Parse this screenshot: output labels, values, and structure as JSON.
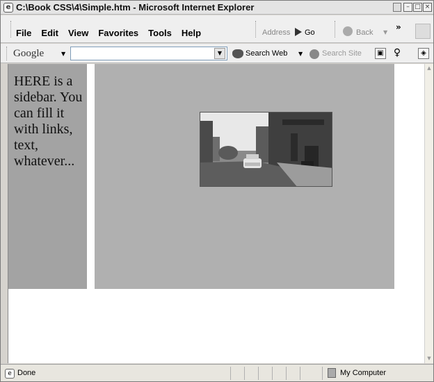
{
  "window": {
    "title": "C:\\Book CSS\\4\\Simple.htm - Microsoft Internet Explorer"
  },
  "menu": {
    "items": [
      "File",
      "Edit",
      "View",
      "Favorites",
      "Tools",
      "Help"
    ]
  },
  "toolbar": {
    "address_label": "Address",
    "go_label": "Go",
    "back_label": "Back",
    "chevron": "»"
  },
  "google_toolbar": {
    "logo_text": "Google",
    "search_value": "",
    "search_web_label": "Search Web",
    "search_site_label": "Search Site"
  },
  "page": {
    "sidebar_text": "HERE is a sidebar. You can fill it with links, text, whatever..."
  },
  "status": {
    "text": "Done",
    "zone": "My Computer"
  }
}
